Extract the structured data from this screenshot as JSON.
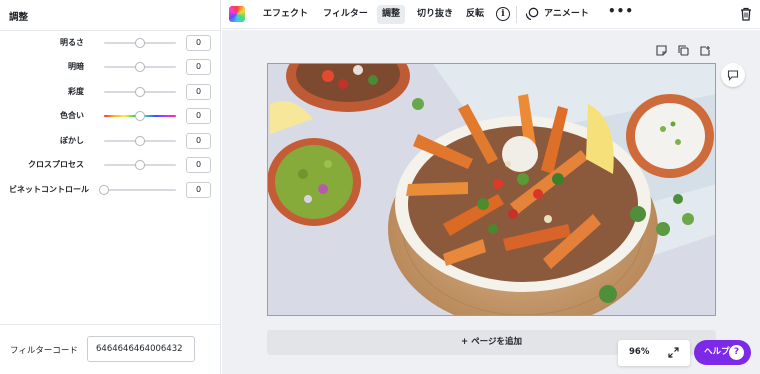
{
  "left_panel": {
    "title": "調整",
    "adjustments": [
      {
        "label": "明るさ",
        "value": "0",
        "level": 0.5
      },
      {
        "label": "明暗",
        "value": "0",
        "level": 0.5
      },
      {
        "label": "彩度",
        "value": "0",
        "level": 0.5
      },
      {
        "label": "色合い",
        "value": "0",
        "level": 0.5
      },
      {
        "label": "ぼかし",
        "value": "0",
        "level": 0.5
      },
      {
        "label": "クロスプロセス",
        "value": "0",
        "level": 0.5
      },
      {
        "label": "ビネットコントロール",
        "value": "0",
        "level": 0.0
      }
    ],
    "filter_code_label": "フィルターコード",
    "filter_code_value": "6464646464006432"
  },
  "toolbar": {
    "color_icon": "color-palette-icon",
    "effects": "エフェクト",
    "filter": "フィルター",
    "adjust": "調整",
    "crop": "切り抜き",
    "flip": "反転",
    "info_icon": "info-icon",
    "animate": "アニメート",
    "more_icon": "more-dots-icon",
    "delete_icon": "trash-icon"
  },
  "canvas": {
    "add_page_label": "+ ページを追加",
    "zoom": "96%",
    "help_label": "ヘルプ",
    "help_q": "?"
  },
  "colors": {
    "accent_purple": "#7d2ae8",
    "selection_teal": "#39c8d0",
    "canvas_bg": "#eef0f3"
  }
}
